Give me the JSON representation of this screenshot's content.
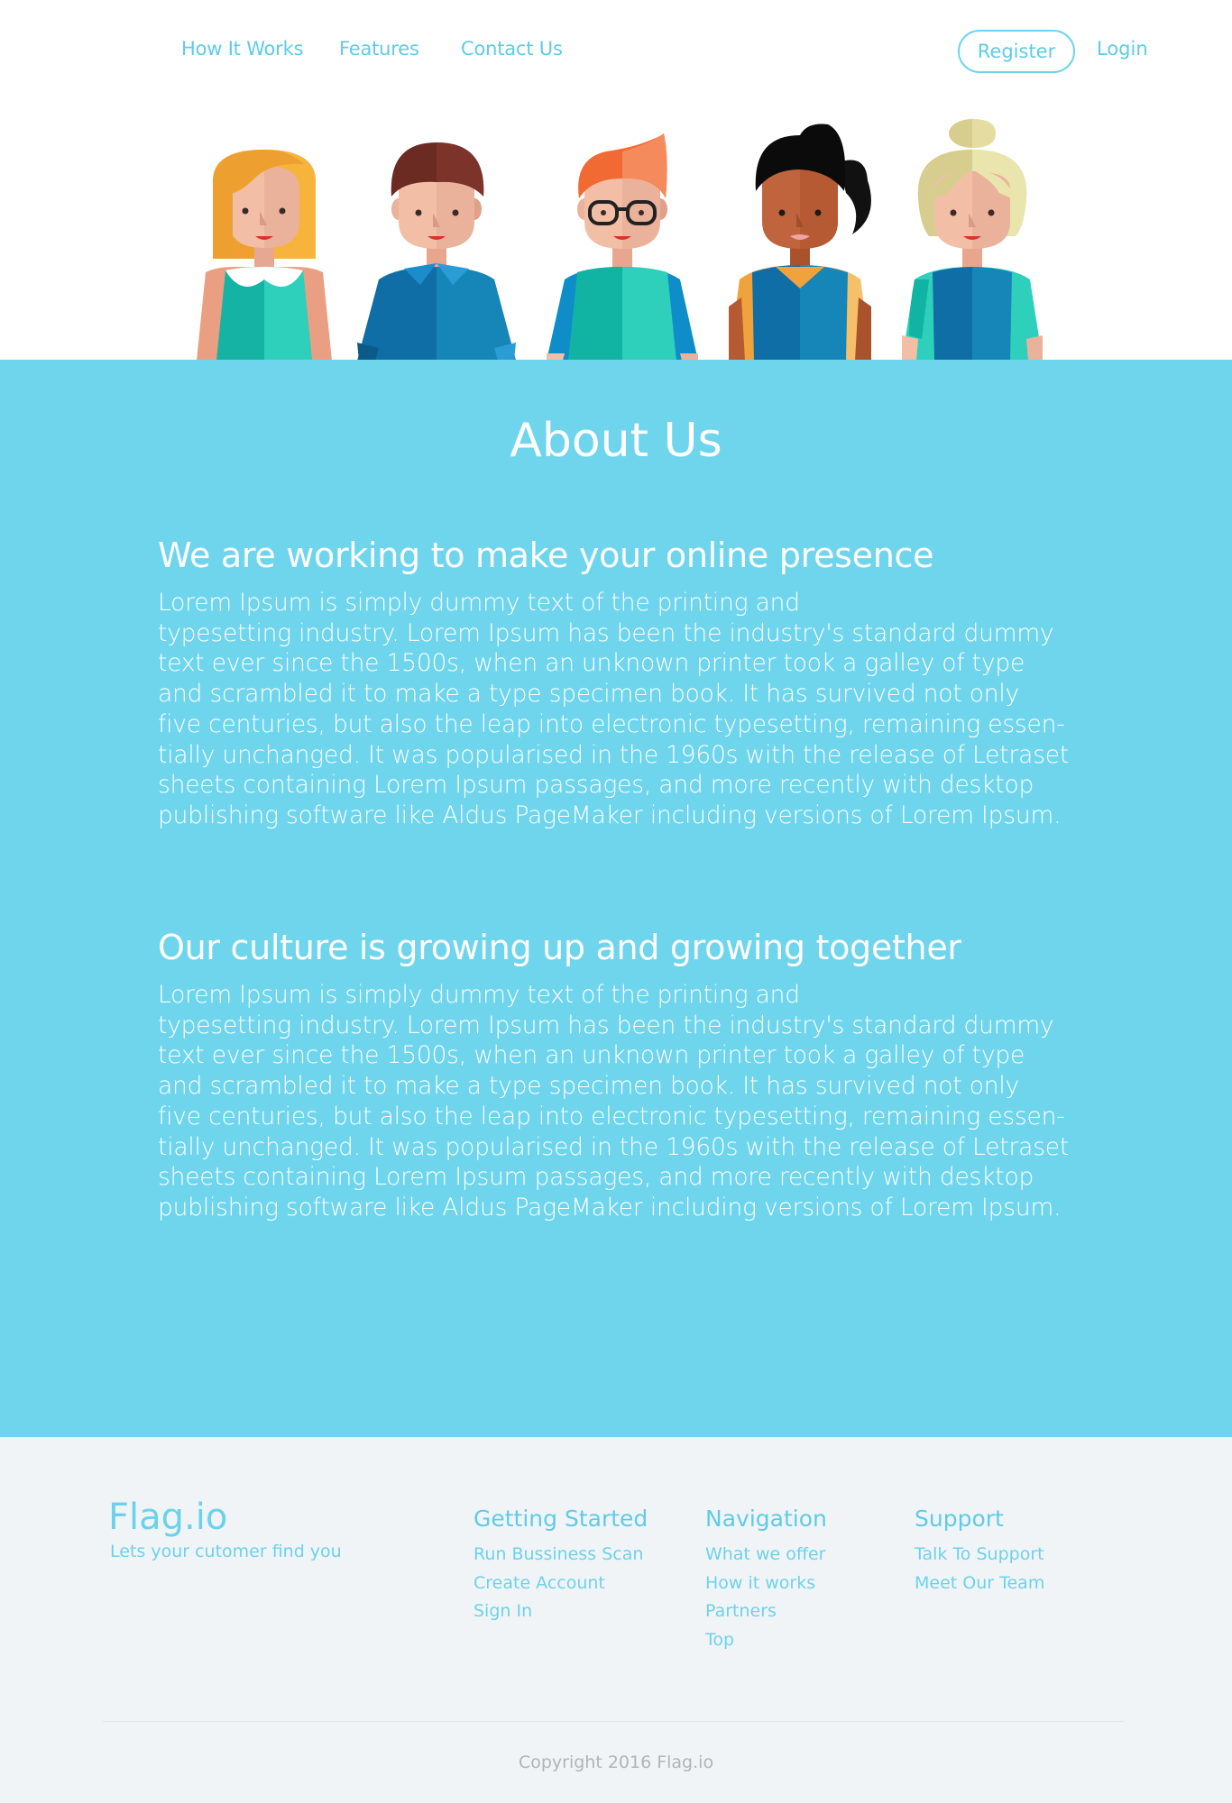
{
  "nav": {
    "links": [
      "How It Works",
      "Features",
      "Contact Us"
    ],
    "register": "Register",
    "login": "Login"
  },
  "colors": {
    "accent": "#6ed5ed",
    "link": "#5fcbe6",
    "footer_bg": "#f1f4f7",
    "copyright": "#b0b4b8"
  },
  "hero": {
    "illustration": "team-of-five-cartoon-characters"
  },
  "about": {
    "title": "About Us",
    "sections": [
      {
        "heading": "We are working to make your online presence",
        "lines": [
          "Lorem Ipsum is simply dummy text of the printing and",
          "typesetting industry. Lorem Ipsum has been the industry's standard dummy",
          "text ever since the 1500s, when an unknown printer took a galley of type",
          "and scrambled it to make a type specimen book. It has survived not only",
          "five centuries, but also the leap into electronic typesetting, remaining essen-",
          "tially unchanged. It was popularised in the 1960s with the release of Letraset",
          "sheets containing Lorem Ipsum passages, and more recently with desktop",
          "publishing software like Aldus PageMaker including versions of Lorem Ipsum."
        ]
      },
      {
        "heading": "Our culture is growing up and growing together",
        "lines": [
          "Lorem Ipsum is simply dummy text of the printing and",
          "typesetting industry. Lorem Ipsum has been the industry's standard dummy",
          "text ever since the 1500s, when an unknown printer took a galley of type",
          "and scrambled it to make a type specimen book. It has survived not only",
          "five centuries, but also the leap into electronic typesetting, remaining essen-",
          "tially unchanged. It was popularised in the 1960s with the release of Letraset",
          "sheets containing Lorem Ipsum passages, and more recently with desktop",
          "publishing software like Aldus PageMaker including versions of Lorem Ipsum."
        ]
      }
    ]
  },
  "footer": {
    "brand": "Flag.io",
    "tagline": "Lets your cutomer find you",
    "columns": [
      {
        "title": "Getting Started",
        "links": [
          "Run Bussiness Scan",
          "Create Account",
          "Sign In"
        ]
      },
      {
        "title": "Navigation",
        "links": [
          "What we offer",
          "How it works",
          "Partners",
          "Top"
        ]
      },
      {
        "title": "Support",
        "links": [
          "Talk To Support",
          "Meet Our Team"
        ]
      }
    ],
    "copyright": "Copyright 2016 Flag.io"
  }
}
